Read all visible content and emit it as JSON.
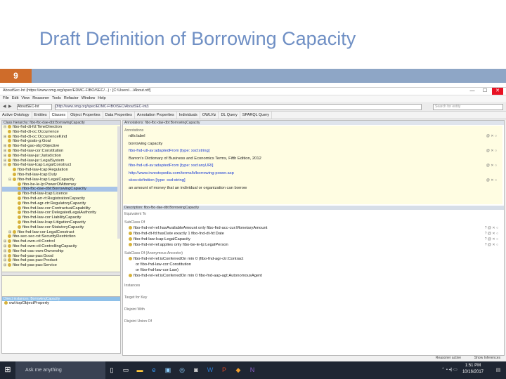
{
  "slide": {
    "title": "Draft Definition of Borrowing Capacity",
    "number": "9"
  },
  "window": {
    "title": "AboutSec-Int (https://www.omg.org/spec/EDMC-FIBO/SEC/...) : [C:\\Users\\...\\About.rdf]",
    "buttons": {
      "minimize": "—",
      "maximize": "☐",
      "close": "✕"
    }
  },
  "menu": [
    "File",
    "Edit",
    "View",
    "Reasoner",
    "Tools",
    "Refactor",
    "Window",
    "Help"
  ],
  "address": {
    "ontology": "AboutSEC-Int",
    "url": "(http://www.omg.org/spec/EDMC-FIBO/SEC/AboutSEC-Int/)",
    "search_placeholder": "Search for entity"
  },
  "tabs": [
    "Active Ontology",
    "Entities",
    "Classes",
    "Object Properties",
    "Data Properties",
    "Annotation Properties",
    "Individuals",
    "OWLViz",
    "DL Query",
    "SPARQL Query"
  ],
  "active_tab": "Classes",
  "tree": {
    "header": "Class hierarchy: fibo-fbc-dae-dbt:BorrowingCapacity",
    "rows": [
      {
        "exp": "⊟",
        "label": "fibo-fnd-dt-fd:TimeDirection",
        "indent": 0
      },
      {
        "exp": "",
        "label": "fibo-fnd-dt-oc:Occurrence",
        "indent": 0
      },
      {
        "exp": "⊞",
        "label": "fibo-fnd-dt-oc:OccurrenceKind",
        "indent": 0
      },
      {
        "exp": "",
        "label": "fibo-fnd-goals-g:Goal",
        "indent": 0
      },
      {
        "exp": "⊞",
        "label": "fibo-fnd-gao-obj:Objective",
        "indent": 0
      },
      {
        "exp": "⊞",
        "label": "fibo-fnd-law-cor:Constitution",
        "indent": 0
      },
      {
        "exp": "⊞",
        "label": "fibo-fnd-law-jur:Jurisdiction",
        "indent": 0
      },
      {
        "exp": "⊞",
        "label": "fibo-fnd-law-jur:LegalSystem",
        "indent": 0
      },
      {
        "exp": "⊟",
        "label": "fibo-fnd-law-lcap:LegalConstruct",
        "indent": 0
      },
      {
        "exp": "",
        "label": "fibo-fnd-law-lcap:Regulation",
        "indent": 1
      },
      {
        "exp": "",
        "label": "fibo-fnd-law-lcap:Duty",
        "indent": 1
      },
      {
        "exp": "⊟",
        "label": "fibo-fnd-law-lcap:LegalCapacity",
        "indent": 1
      },
      {
        "exp": "",
        "label": "fibo-be-le-lp:PowerOfAttorney",
        "indent": 2
      },
      {
        "exp": "",
        "label": "fibo-fbc-dae-dbt:BorrowingCapacity",
        "indent": 2,
        "selected": true
      },
      {
        "exp": "",
        "label": "fibo-fnd-law-lcap:Licence",
        "indent": 2
      },
      {
        "exp": "",
        "label": "fibo-fnd-arr-rt:RegistrationCapacity",
        "indent": 2
      },
      {
        "exp": "",
        "label": "fibo-fnd-agr-ctr:RegulatoryCapacity",
        "indent": 2
      },
      {
        "exp": "",
        "label": "fibo-fnd-law-cor:ContractualCapability",
        "indent": 2
      },
      {
        "exp": "",
        "label": "fibo-fnd-law-cor:DelegatedLegalAuthority",
        "indent": 2
      },
      {
        "exp": "",
        "label": "fibo-fnd-law-cor:LiabilityCapacity",
        "indent": 2
      },
      {
        "exp": "",
        "label": "fibo-fnd-law-lcap:LitigationCapacity",
        "indent": 2
      },
      {
        "exp": "",
        "label": "fibo-fnd-law-cor:StatutoryCapacity",
        "indent": 2
      },
      {
        "exp": "⊞",
        "label": "fibo-fnd-law-cor:LegalConstruct",
        "indent": 1
      },
      {
        "exp": "",
        "label": "fibo-sec-sec-rst:SecurityRestriction",
        "indent": 0
      },
      {
        "exp": "⊞",
        "label": "fibo-fnd-own-ctl:Control",
        "indent": 0
      },
      {
        "exp": "⊞",
        "label": "fibo-fnd-own-ctl:ControllingCapacity",
        "indent": 0
      },
      {
        "exp": "⊞",
        "label": "fibo-fnd-oac-own:Ownership",
        "indent": 0
      },
      {
        "exp": "⊞",
        "label": "fibo-fnd-pas-pas:Good",
        "indent": 0
      },
      {
        "exp": "⊞",
        "label": "fibo-fnd-pas-pas:Product",
        "indent": 0
      },
      {
        "exp": "⊞",
        "label": "fibo-fnd-pas-pas:Service",
        "indent": 0
      }
    ]
  },
  "lower_left": {
    "header": "Direct instances: BorrowingCapacity",
    "rows": [
      "owl:topObjectProperty"
    ]
  },
  "annotations": {
    "header": "Annotations: fibo-fbc-dae-dbt:BorrowingCapacity",
    "section_label": "Annotations",
    "rows": [
      {
        "text": "rdfs:label",
        "link": false
      },
      {
        "text": "borrowing capacity",
        "link": false
      },
      {
        "text": "fibo-fnd-utl-av:adaptedFrom  [type: xsd:string]",
        "link": true
      },
      {
        "text": "Barron's Dictionary of Business and Economics Terms, Fifth Edition, 2012",
        "link": false
      },
      {
        "text": "fibo-fnd-utl-av:adaptedFrom  [type: xsd:anyURI]",
        "link": true
      },
      {
        "text": "http://www.investopedia.com/terms/b/borrowing-power.asp",
        "link": true
      },
      {
        "text": "skos:definition  [type: xsd:string]",
        "link": true
      },
      {
        "text": "an amount of money that an individual or organization can borrow",
        "link": false
      }
    ]
  },
  "description": {
    "header": "Description: fibo-fbc-dae-dbt:BorrowingCapacity",
    "equivalent_label": "Equivalent To",
    "subclass_label": "SubClass Of",
    "subclass_rows": [
      "fibo-fnd-rel-rel:hasAvailableAmount only fibo-fnd-acc-cur:MonetaryAmount",
      "fibo-fnd-dt-fd:hasDate exactly 1 fibo-fnd-dt-fd:Date",
      "fibo-fnd-law-lcap:LegalCapacity",
      "fibo-fnd-rel-rel:applies only fibo-be-le-lp:LegalPerson"
    ],
    "general_label": "SubClass Of (Anonymous Ancestor)",
    "general_rows": [
      "fibo-fnd-rel-rel:isConferredOn min 0 (fibo-fnd-agr-ctr:Contract",
      "or fibo-fnd-law-cor:Constitution",
      "or fibo-fnd-law-cor:Law)",
      "fibo-fnd-rel-rel:isConferredOn min 0 fibo-fnd-aap-agt:AutonomousAgent"
    ],
    "more_labels": [
      "Instances",
      "Target for Key",
      "Disjoint With",
      "Disjoint Union Of"
    ]
  },
  "status": {
    "reasoner": "Reasoner active",
    "show_inferences": "Show Inferences"
  },
  "taskbar": {
    "start": "⊞",
    "search": "Ask me anything",
    "time": "1:51 PM",
    "date": "10/16/2017"
  },
  "colors": {
    "title": "#6f8fc4",
    "slide_number_bg": "#cf6c2a",
    "tree_bg": "#fdfde0",
    "selected_row": "#a8c4e8",
    "class_dot": "#d6b23c",
    "taskbar": "#1f2633"
  }
}
